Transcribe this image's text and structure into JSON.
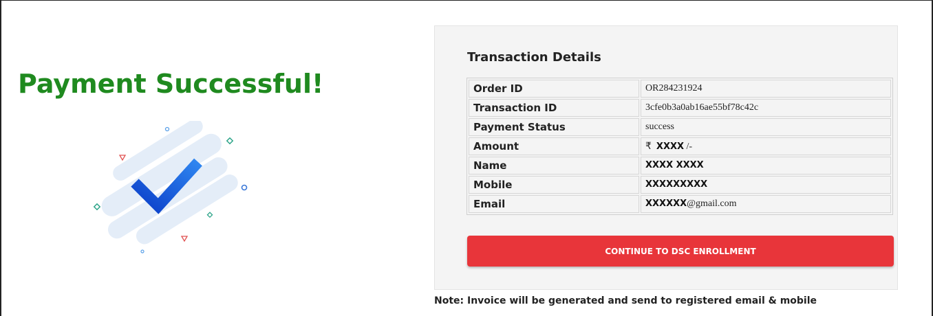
{
  "page": {
    "title": "Payment Successful!",
    "note": "Note: Invoice will be generated and send to registered email & mobile"
  },
  "transaction": {
    "heading": "Transaction Details",
    "rows": [
      {
        "label": "Order ID",
        "value": "OR284231924"
      },
      {
        "label": "Transaction ID",
        "value": "3cfe0b3a0ab16ae55bf78c42c"
      },
      {
        "label": "Payment Status",
        "value": "success"
      },
      {
        "label": "Amount",
        "currency": "₹",
        "value": "XXXX",
        "suffix": "/-"
      },
      {
        "label": "Name",
        "value": "XXXX XXXX"
      },
      {
        "label": "Mobile",
        "value": "XXXXXXXXX"
      },
      {
        "label": "Email",
        "value_masked": "XXXXXX",
        "value_domain": "@gmail.com"
      }
    ]
  },
  "actions": {
    "continue_label": "CONTINUE TO DSC ENROLLMENT"
  },
  "colors": {
    "success_green": "#1f8a1f",
    "button_red": "#e8353a",
    "check_blue": "#1f5fe0"
  },
  "icons": {
    "illustration": "checkmark-success-icon"
  }
}
